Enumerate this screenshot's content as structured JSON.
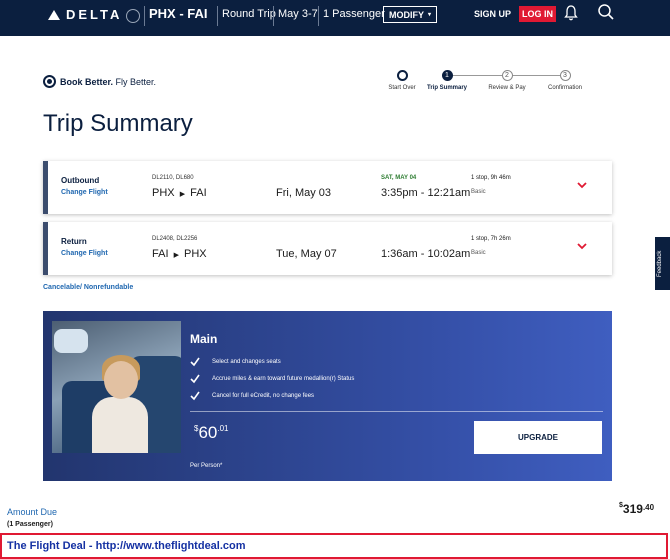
{
  "nav": {
    "brand": "DELTA",
    "route": "PHX - FAI",
    "trip_type": "Round Trip",
    "dates": "May 3-7",
    "passengers": "1 Passenger",
    "modify_label": "MODIFY",
    "signup_label": "SIGN UP",
    "login_label": "LOG IN",
    "icons": [
      "delta-triangle-icon",
      "skyteam-icon",
      "bell-icon",
      "search-icon"
    ],
    "colors": {
      "background": "#0b1f3f",
      "login": "#e01933"
    }
  },
  "brand_tagline": {
    "bold": "Book Better.",
    "rest": " Fly Better."
  },
  "progress": {
    "steps": [
      {
        "num": "",
        "label": "Start Over",
        "state": "startover"
      },
      {
        "num": "1",
        "label": "Trip Summary",
        "state": "active"
      },
      {
        "num": "2",
        "label": "Review & Pay",
        "state": "todo"
      },
      {
        "num": "3",
        "label": "Confirmation",
        "state": "todo"
      }
    ]
  },
  "page_title": "Trip Summary",
  "flights": [
    {
      "direction": "Outbound",
      "change_label": "Change Flight",
      "flight_numbers": "DL2110, DL680",
      "origin": "PHX",
      "destination": "FAI",
      "date": "Fri, May 03",
      "arrival_note": "SAT, MAY 04",
      "times": "3:35pm - 12:21am",
      "stops": "1 stop, 9h 46m",
      "fare": "Basic"
    },
    {
      "direction": "Return",
      "change_label": "Change Flight",
      "flight_numbers": "DL2408, DL2256",
      "origin": "FAI",
      "destination": "PHX",
      "date": "Tue, May 07",
      "arrival_note": "",
      "times": "1:36am - 10:02am",
      "stops": "1 stop, 7h 26m",
      "fare": "Basic"
    }
  ],
  "cancel_policy": "Cancelable/ Nonrefundable",
  "upsell": {
    "title": "Main",
    "features": [
      "Select and changes seats",
      "Accrue miles & earn toward future medallion(r) Status",
      "Cancel for full eCredit, no change fees"
    ],
    "price_currency": "$",
    "price_whole": "60",
    "price_cents": ".01",
    "per_person": "Per Person*",
    "button_label": "UPGRADE"
  },
  "feedback_label": "Feedback",
  "amount_due": {
    "label": "Amount Due",
    "sub": "(1 Passenger)",
    "currency": "$",
    "whole": "319",
    "cents": ".40"
  },
  "banner_text": "The Flight Deal - http://www.theflightdeal.com"
}
